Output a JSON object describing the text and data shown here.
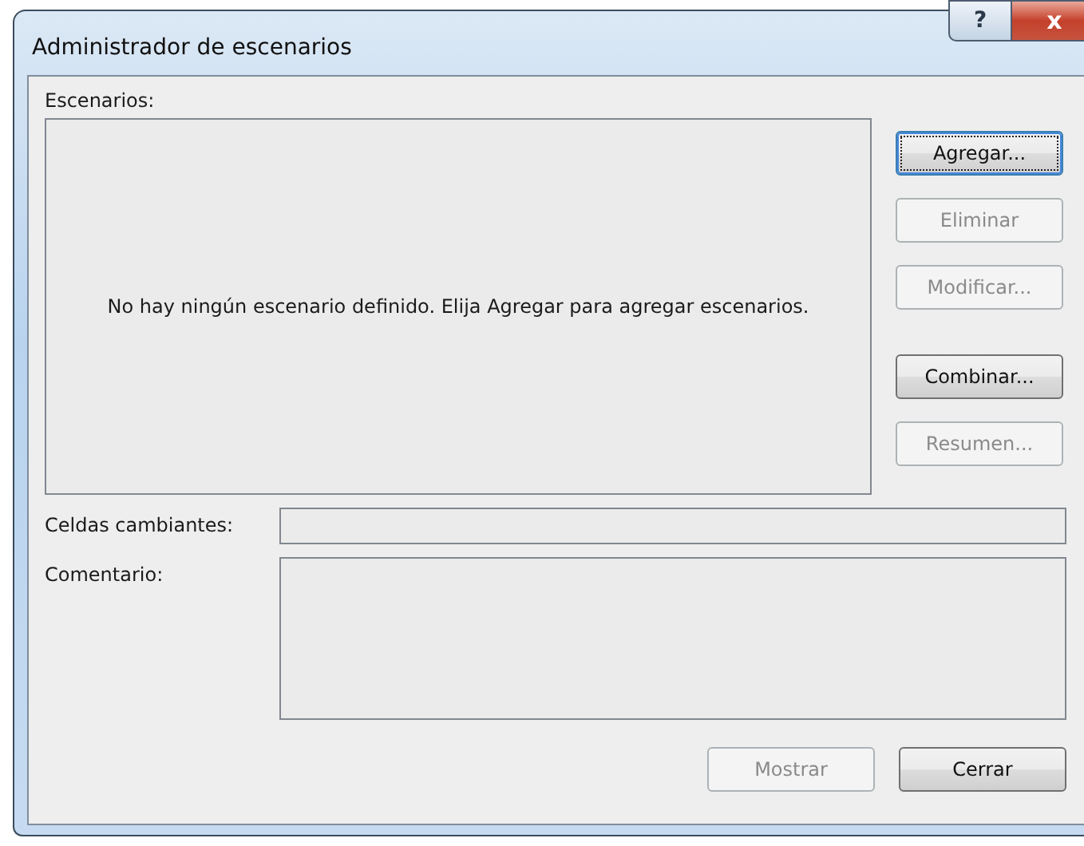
{
  "window": {
    "title": "Administrador de escenarios",
    "caption_buttons": [
      {
        "kind": "help",
        "label": "?"
      },
      {
        "kind": "close",
        "label": "x"
      }
    ]
  },
  "scenarios": {
    "label": "Escenarios:",
    "empty_message": "No hay ningún escenario definido. Elija Agregar para agregar escenarios."
  },
  "side_buttons": [
    {
      "label": "Agregar...",
      "disabled": false,
      "focused": true
    },
    {
      "label": "Eliminar",
      "disabled": true,
      "focused": false
    },
    {
      "label": "Modificar...",
      "disabled": true,
      "focused": false
    },
    {
      "label": "Combinar...",
      "disabled": false,
      "focused": false
    },
    {
      "label": "Resumen...",
      "disabled": true,
      "focused": false
    }
  ],
  "changing_cells": {
    "label": "Celdas cambiantes:"
  },
  "comment": {
    "label": "Comentario:"
  },
  "footer_buttons": [
    {
      "label": "Mostrar",
      "disabled": true
    },
    {
      "label": "Cerrar",
      "disabled": false
    }
  ]
}
